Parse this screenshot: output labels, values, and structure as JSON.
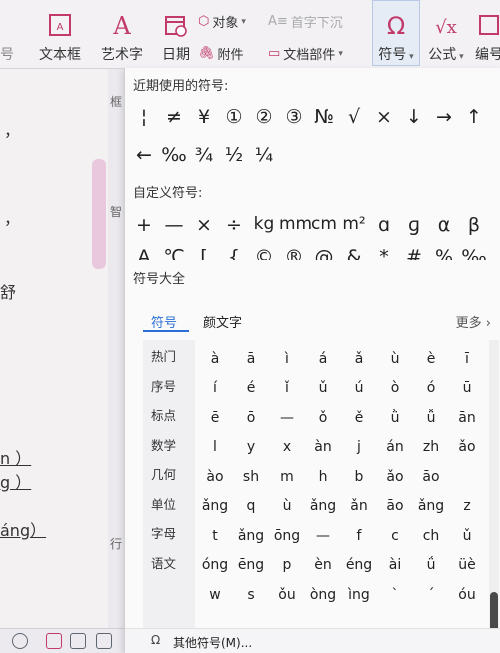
{
  "ribbon": {
    "buttons": [
      {
        "label": "文本框",
        "icon": "textbox-icon"
      },
      {
        "label": "艺术字",
        "icon": "wordart-icon"
      },
      {
        "label": "日期",
        "icon": "date-icon"
      },
      {
        "label": "附件",
        "icon": "attachment-icon"
      },
      {
        "label": "文档部件",
        "icon": "doc-parts-icon"
      },
      {
        "label": "符号",
        "icon": "omega-icon"
      },
      {
        "label": "公式",
        "icon": "formula-icon"
      },
      {
        "label": "编号",
        "icon": "numbering-icon"
      }
    ],
    "object_label": "对象",
    "dropcap_label": "首字下沉",
    "accent_color": "#2b6fd6"
  },
  "popup": {
    "recent_title": "近期使用的符号:",
    "recent_row1": [
      "¦",
      "≠",
      "¥",
      "①",
      "②",
      "③",
      "№",
      "√",
      "×",
      "↓",
      "→",
      "↑"
    ],
    "recent_row2": [
      "←",
      "‰",
      "¾",
      "½",
      "¼"
    ],
    "custom_title": "自定义符号:",
    "custom_row1": [
      "+",
      "—",
      "×",
      "÷",
      "kg",
      "mm",
      "cm",
      "m²",
      "ɑ",
      "ɡ",
      "α",
      "β"
    ],
    "custom_row2": [
      "A",
      "℃",
      "[",
      "{",
      "©",
      "®",
      "@",
      "&",
      "*",
      "#",
      "%",
      "‰"
    ],
    "all_title": "符号大全",
    "tabs": [
      "符号",
      "颜文字"
    ],
    "more_label": "更多",
    "categories": [
      "热门",
      "序号",
      "标点",
      "数学",
      "几何",
      "单位",
      "字母",
      "语文"
    ],
    "grid": [
      [
        "à",
        "ā",
        "ì",
        "á",
        "ǎ",
        "ù",
        "è",
        "ī"
      ],
      [
        "í",
        "é",
        "ǐ",
        "ǔ",
        "ú",
        "ò",
        "ó",
        "ū"
      ],
      [
        "ē",
        "ō",
        "—",
        "ǒ",
        "ě",
        "ǜ",
        "ǚ",
        "ān"
      ],
      [
        "l",
        "y",
        "x",
        "àn",
        "j",
        "án",
        "zh",
        "ǎo"
      ],
      [
        "ào",
        "sh",
        "m",
        "h",
        "b",
        "ǎo",
        "āo"
      ],
      [
        "ǎng",
        "q",
        "ù",
        "ǎng",
        "ǎn",
        "āo",
        "ǎng",
        "z"
      ],
      [
        "t",
        "ǎng",
        "ōng",
        "—",
        "f",
        "c",
        "ch",
        "ǔ"
      ],
      [
        "óng",
        "ēng",
        "p",
        "èn",
        "éng",
        "ài",
        "ǘ",
        "üè"
      ],
      [
        "w",
        "s",
        "ǒu",
        "òng",
        "ìng",
        "ˋ",
        "ˊ",
        "óu"
      ]
    ],
    "footer_label": "其他符号(M)..."
  },
  "document": {
    "side_texts": [
      "，",
      "，",
      "舒",
      "n ）",
      "g ）",
      "áng）"
    ],
    "ruler_labels": [
      "框",
      "智",
      "行"
    ]
  }
}
